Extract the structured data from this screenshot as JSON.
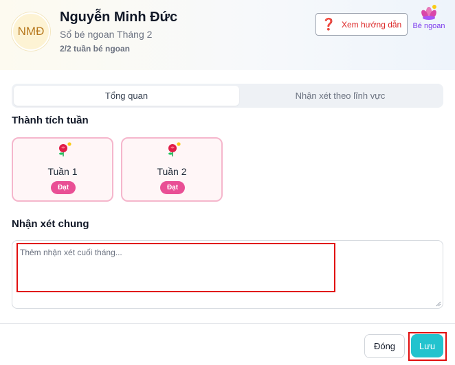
{
  "student": {
    "initials": "NMĐ",
    "name": "Nguyễn Minh Đức",
    "subtitle": "Sổ bé ngoan Tháng 2",
    "progress": "2/2 tuần bé ngoan"
  },
  "header_actions": {
    "guide_label": "Xem hướng dẫn",
    "badge_label": "Bé ngoan"
  },
  "tabs": [
    {
      "label": "Tổng quan",
      "active": true
    },
    {
      "label": "Nhận xét theo lĩnh vực",
      "active": false
    }
  ],
  "achievements": {
    "title": "Thành tích tuần",
    "weeks": [
      {
        "label": "Tuần 1",
        "status": "Đạt",
        "icon": "rose-icon"
      },
      {
        "label": "Tuần 2",
        "status": "Đạt",
        "icon": "rose-icon"
      }
    ]
  },
  "comment": {
    "title": "Nhận xét chung",
    "placeholder": "Thêm nhận xét cuối tháng...",
    "value": ""
  },
  "footer": {
    "close_label": "Đóng",
    "save_label": "Lưu"
  },
  "colors": {
    "accent": "#22c3ce",
    "status_pink": "#e94f95",
    "card_border": "#f5b6cc",
    "highlight_red": "#e10e0e"
  }
}
